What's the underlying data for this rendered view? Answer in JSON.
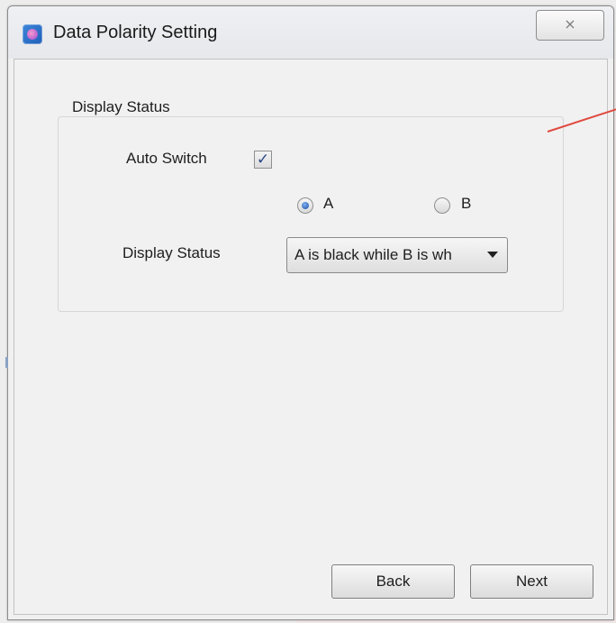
{
  "window": {
    "title": "Data Polarity Setting",
    "close_glyph": "⨯",
    "accent_color": "#2f6fc9"
  },
  "group": {
    "legend": "Display Status",
    "auto_switch_label": "Auto Switch",
    "auto_switch_checked": true,
    "radio_a_label": "A",
    "radio_b_label": "B",
    "selected_radio": "A",
    "display_status_label": "Display Status",
    "display_status_value": "A is black while B is wh"
  },
  "footer": {
    "back_label": "Back",
    "next_label": "Next"
  }
}
